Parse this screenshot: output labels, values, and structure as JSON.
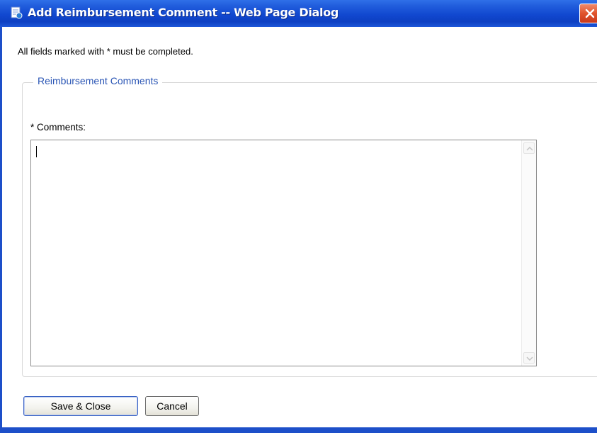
{
  "window": {
    "title": "Add Reimbursement Comment -- Web Page Dialog",
    "title_icon": "page-dialog-icon",
    "close_icon": "close-icon"
  },
  "form": {
    "required_note": "All fields marked with * must be completed.",
    "fieldset_legend": "Reimbursement Comments",
    "comments_label": "* Comments:",
    "comments_value": ""
  },
  "buttons": {
    "save_close": "Save & Close",
    "cancel": "Cancel"
  },
  "colors": {
    "titlebar": "#1148d0",
    "legend_text": "#2b56b5",
    "close_button": "#e0542c"
  }
}
